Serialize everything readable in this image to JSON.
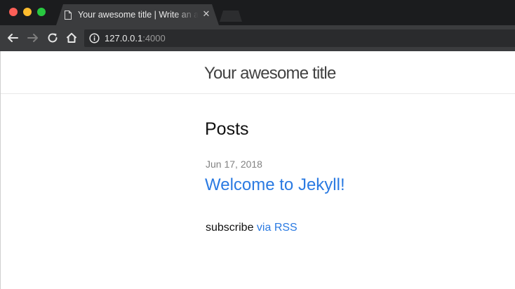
{
  "browser": {
    "tab": {
      "title": "Your awesome title | Write an awesome description",
      "close_glyph": "✕"
    },
    "address": {
      "host": "127.0.0.1",
      "port": ":4000"
    }
  },
  "site": {
    "title": "Your awesome title"
  },
  "main": {
    "heading": "Posts",
    "posts": [
      {
        "date": "Jun 17, 2018",
        "title": "Welcome to Jekyll!"
      }
    ],
    "subscribe": {
      "prefix": "subscribe ",
      "link_label": "via RSS"
    }
  },
  "colors": {
    "link": "#2a7ae2",
    "chrome_dark": "#1b1c1e",
    "chrome_toolbar": "#3b3c3e"
  }
}
